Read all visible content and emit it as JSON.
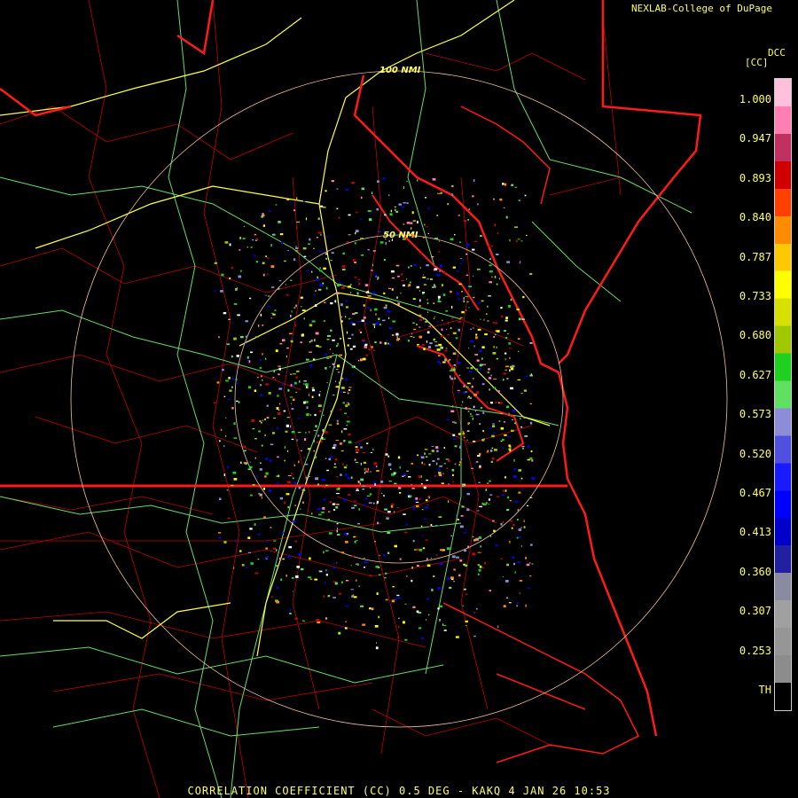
{
  "credit": "NEXLAB-College of DuPage",
  "colorbar": {
    "product": "DCC",
    "unit": "[CC]",
    "ticks": [
      "1.000",
      "0.947",
      "0.893",
      "0.840",
      "0.787",
      "0.733",
      "0.680",
      "0.627",
      "0.573",
      "0.520",
      "0.467",
      "0.413",
      "0.360",
      "0.307",
      "0.253",
      "TH"
    ],
    "colors": [
      "#000000",
      "#8c8c8c",
      "#969696",
      "#a0a0a0",
      "#8a8aa0",
      "#2020a0",
      "#0000c8",
      "#0000ff",
      "#1a1aff",
      "#5050e0",
      "#8c8cd8",
      "#60e060",
      "#20d020",
      "#a0c800",
      "#d8e000",
      "#ffff00",
      "#ffc800",
      "#ff8c00",
      "#ff4000",
      "#d00000",
      "#c03060",
      "#ff80b0",
      "#ffc0dc"
    ]
  },
  "range_rings": {
    "inner_label": "50 NMI",
    "outer_label": "100 NMI"
  },
  "caption": "CORRELATION COEFFICIENT (CC) 0.5 DEG - KAKQ 4 JAN 26 10:53"
}
